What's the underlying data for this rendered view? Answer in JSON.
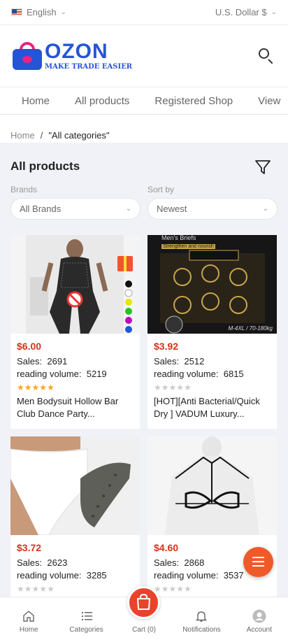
{
  "topbar": {
    "language": "English",
    "currency": "U.S. Dollar $"
  },
  "logo": {
    "name": "OZON",
    "tagline": "MAKE TRADE EASIER"
  },
  "nav": {
    "tabs": [
      "Home",
      "All products",
      "Registered Shop",
      "View"
    ]
  },
  "breadcrumb": {
    "home": "Home",
    "separator": "/",
    "current": "\"All categories\""
  },
  "page": {
    "title": "All products"
  },
  "filters": {
    "brands_label": "Brands",
    "brands_value": "All Brands",
    "sort_label": "Sort by",
    "sort_value": "Newest"
  },
  "products": [
    {
      "price": "$6.00",
      "sales_label": "Sales:",
      "sales": "2691",
      "reading_label": "reading volume:",
      "reading": "5219",
      "rating": 4.5,
      "name_line1": "Men Bodysuit Hollow Bar",
      "name_line2": "Club Dance Party..."
    },
    {
      "price": "$3.92",
      "sales_label": "Sales:",
      "sales": "2512",
      "reading_label": "reading volume:",
      "reading": "6815",
      "rating": 0,
      "name_line1": "[HOT][Anti Bacterial/Quick",
      "name_line2": "Dry ] VADUM Luxury...",
      "image_text1": "Men's Briefs",
      "image_text2": "Strengthen and nourish",
      "image_text3": "M-4XL / 70-180kg"
    },
    {
      "price": "$3.72",
      "sales_label": "Sales:",
      "sales": "2623",
      "reading_label": "reading volume:",
      "reading": "3285",
      "rating": 0
    },
    {
      "price": "$4.60",
      "sales_label": "Sales:",
      "sales": "2868",
      "reading_label": "reading volume:",
      "reading": "3537",
      "rating": 0
    }
  ],
  "bottom_nav": [
    {
      "label": "Home",
      "icon": "home-icon"
    },
    {
      "label": "Categories",
      "icon": "list-icon"
    },
    {
      "label": "Cart (0)",
      "icon": "shopping-bag-icon"
    },
    {
      "label": "Notifications",
      "icon": "bell-icon"
    },
    {
      "label": "Account",
      "icon": "user-icon"
    }
  ],
  "colors": {
    "accent": "#f05a28",
    "price": "#d9301e",
    "brand": "#2554d6",
    "brand_secondary": "#e8237f"
  }
}
